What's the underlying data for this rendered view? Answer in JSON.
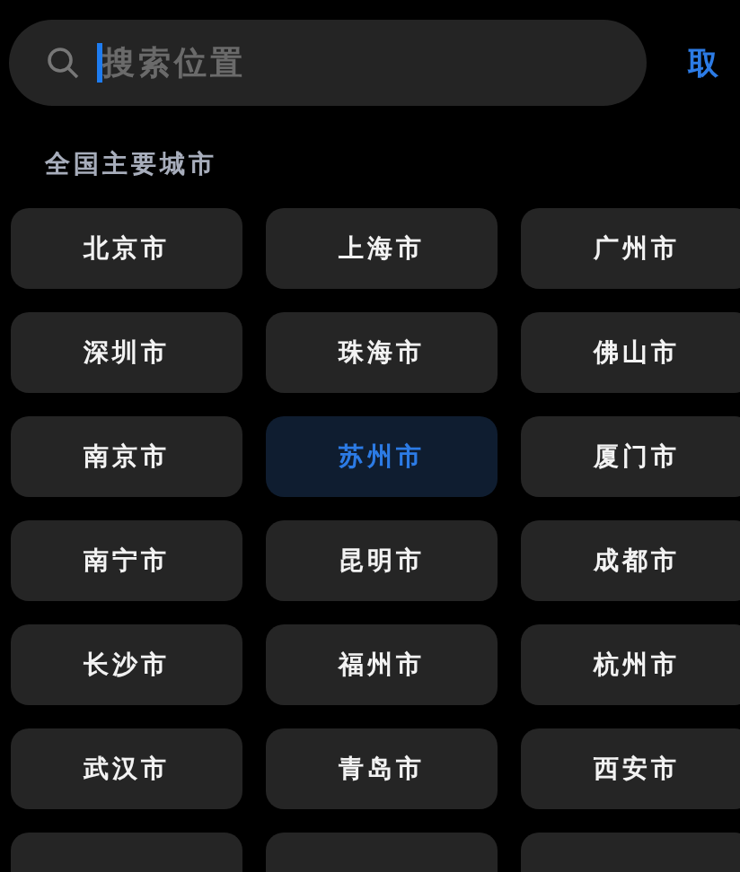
{
  "search": {
    "placeholder": "搜索位置",
    "focused": true
  },
  "cancel_button": "取",
  "section_title": "全国主要城市",
  "cities": [
    {
      "label": "北京市",
      "selected": false
    },
    {
      "label": "上海市",
      "selected": false
    },
    {
      "label": "广州市",
      "selected": false
    },
    {
      "label": "深圳市",
      "selected": false
    },
    {
      "label": "珠海市",
      "selected": false
    },
    {
      "label": "佛山市",
      "selected": false
    },
    {
      "label": "南京市",
      "selected": false
    },
    {
      "label": "苏州市",
      "selected": true
    },
    {
      "label": "厦门市",
      "selected": false
    },
    {
      "label": "南宁市",
      "selected": false
    },
    {
      "label": "昆明市",
      "selected": false
    },
    {
      "label": "成都市",
      "selected": false
    },
    {
      "label": "长沙市",
      "selected": false
    },
    {
      "label": "福州市",
      "selected": false
    },
    {
      "label": "杭州市",
      "selected": false
    },
    {
      "label": "武汉市",
      "selected": false
    },
    {
      "label": "青岛市",
      "selected": false
    },
    {
      "label": "西安市",
      "selected": false
    }
  ]
}
